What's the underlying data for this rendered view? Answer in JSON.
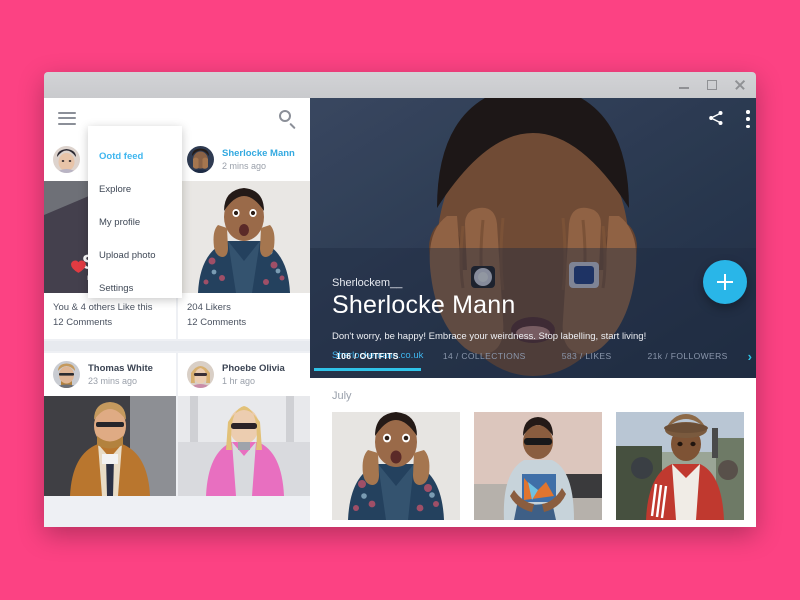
{
  "window": {
    "controls": {
      "minimize": "minimize",
      "maximize": "maximize",
      "close": "close"
    }
  },
  "feed": {
    "toolbar": {
      "menu_icon": "hamburger-icon",
      "search_icon": "search-icon"
    },
    "cards": [
      {
        "author": "",
        "time": "",
        "likes": "You & 4 others Like this",
        "comments": "12 Comments",
        "photo": "sdn-london-jacket"
      },
      {
        "author": "Sherlocke Mann",
        "time": "2 mins ago",
        "likes": "204 Likers",
        "comments": "12 Comments",
        "photo": "floral-jacket-surprised"
      },
      {
        "author": "Thomas White",
        "time": "23 mins ago",
        "likes": "",
        "comments": "",
        "photo": "man-tan-coat-sunglasses"
      },
      {
        "author": "Phoebe Olivia",
        "time": "1 hr ago",
        "likes": "",
        "comments": "",
        "photo": "woman-pink-coat-sunglasses"
      }
    ]
  },
  "dropdown": {
    "items": [
      {
        "label": "Ootd feed",
        "active": true
      },
      {
        "label": "Explore",
        "active": false
      },
      {
        "label": "My profile",
        "active": false
      },
      {
        "label": "Upload photo",
        "active": false
      },
      {
        "label": "Settings",
        "active": false
      }
    ]
  },
  "profile": {
    "handle": "Sherlockem__",
    "name": "Sherlocke Mann",
    "bio": "Don't worry, be happy! Embrace your weirdness. Stop labelling, start living!",
    "website": "Sherlockemann.co.uk",
    "share_icon": "share-icon",
    "more_icon": "more-vertical-icon",
    "fab_icon": "plus-icon",
    "next_icon": "chevron-right-icon",
    "tabs": [
      {
        "label": "106 / OUTFITS",
        "active": true
      },
      {
        "label": "14 / COLLECTIONS",
        "active": false
      },
      {
        "label": "583 / LIKES",
        "active": false
      },
      {
        "label": "21k / FOLLOWERS",
        "active": false
      }
    ]
  },
  "gallery": {
    "month": "July",
    "items": [
      {
        "alt": "floral-jacket-surprised"
      },
      {
        "alt": "grey-sweatshirt-seated"
      },
      {
        "alt": "red-track-jacket-hat"
      }
    ]
  },
  "colors": {
    "page_background": "#fc4283",
    "accent_cyan": "#29b6e8",
    "hero_navy": "#2c3a52",
    "link_blue": "#3fb6ef"
  }
}
